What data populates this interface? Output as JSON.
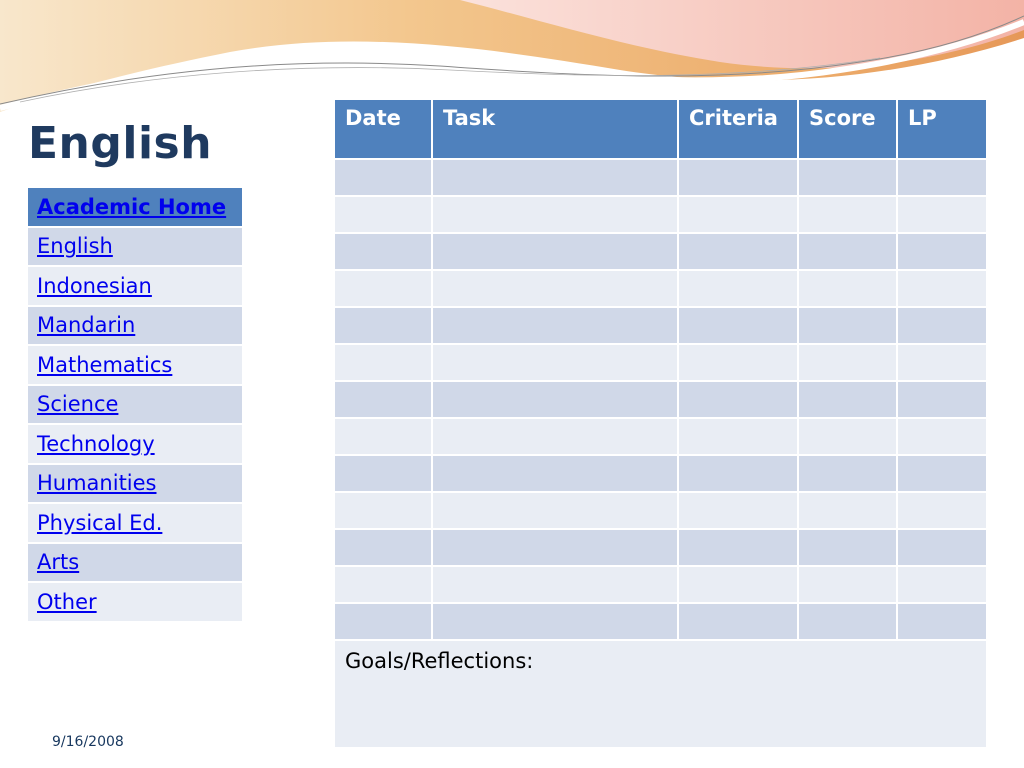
{
  "slide": {
    "title": "English",
    "date": "9/16/2008"
  },
  "colors": {
    "accent": "#4f81bd",
    "row_dark": "#d0d8e8",
    "row_light": "#e9edf4",
    "title": "#1f3a5f",
    "link": "#0000ee"
  },
  "nav": {
    "items": [
      {
        "label": "Academic Home"
      },
      {
        "label": "English"
      },
      {
        "label": "Indonesian"
      },
      {
        "label": "Mandarin"
      },
      {
        "label": "Mathematics"
      },
      {
        "label": "Science"
      },
      {
        "label": "Technology"
      },
      {
        "label": "Humanities"
      },
      {
        "label": "Physical Ed."
      },
      {
        "label": "Arts"
      },
      {
        "label": "Other"
      }
    ]
  },
  "grade_table": {
    "headers": [
      "Date",
      "Task",
      "Criteria",
      "Score",
      "LP"
    ],
    "empty_row_count": 13,
    "goals_label": "Goals/Reflections:"
  }
}
